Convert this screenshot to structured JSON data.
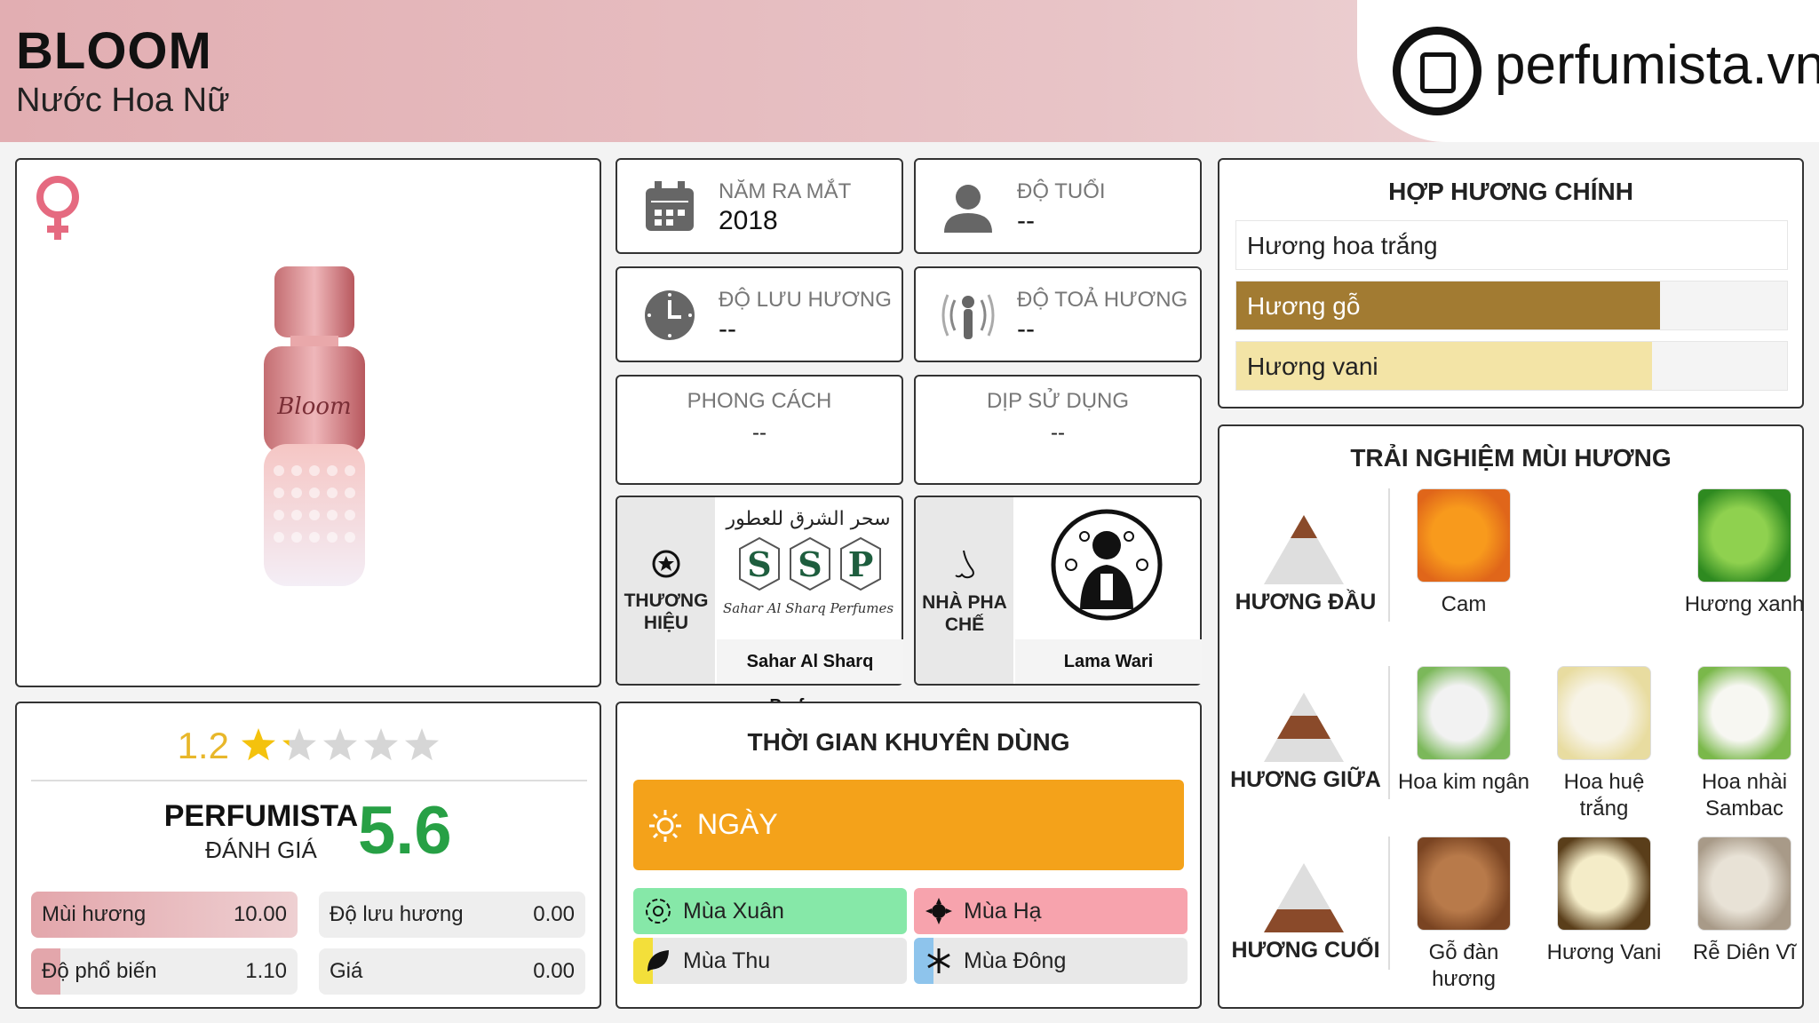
{
  "header": {
    "title": "BLOOM",
    "subtitle": "Nước Hoa Nữ",
    "logo_text": "perfumista.vn"
  },
  "info": {
    "launch_label": "NĂM RA MẮT",
    "launch_value": "2018",
    "age_label": "ĐỘ TUỔI",
    "age_value": "--",
    "longevity_label": "ĐỘ LƯU HƯƠNG",
    "longevity_value": "--",
    "sillage_label": "ĐỘ TOẢ HƯƠNG",
    "sillage_value": "--",
    "style_label": "PHONG CÁCH",
    "style_value": "--",
    "occasion_label": "DỊP SỬ DỤNG",
    "occasion_value": "--",
    "brand_label": "THƯƠNG HIỆU",
    "brand_name": "Sahar Al Sharq Perfumes",
    "brand_arabic": "سحر الشرق للعطور",
    "brand_script": "Sahar Al Sharq Perfumes",
    "perfumer_label": "NHÀ PHA CHẾ",
    "perfumer_name": "Lama Wari"
  },
  "bottle_text": "Bloom",
  "accords": {
    "title": "HỢP HƯƠNG CHÍNH",
    "items": [
      {
        "label": "Hương hoa trắng",
        "fill": 1.0,
        "color": "#ffffff"
      },
      {
        "label": "Hương gỗ",
        "fill": 0.77,
        "color": "#a27b32"
      },
      {
        "label": "Hương vani",
        "fill": 0.755,
        "color": "#f3e4a6"
      }
    ]
  },
  "notes": {
    "title": "TRẢI NGHIỆM MÙI HƯƠNG",
    "top_label": "HƯƠNG ĐẦU",
    "middle_label": "HƯƠNG GIỮA",
    "base_label": "HƯƠNG CUỐI",
    "top": [
      "Cam",
      "Hương xanh"
    ],
    "middle": [
      "Hoa kim ngân",
      "Hoa huệ trắng",
      "Hoa nhài Sambac"
    ],
    "base": [
      "Gỗ đàn hương",
      "Hương Vani",
      "Rễ Diên Vĩ"
    ]
  },
  "rating": {
    "score": "1.2",
    "stars": 1.2,
    "perfumista_label": "PERFUMISTA",
    "review_label": "ĐÁNH GIÁ",
    "perfumista_score": "5.6",
    "stats": [
      {
        "label": "Mùi hương",
        "value": "10.00",
        "fill": 1.0
      },
      {
        "label": "Độ lưu hương",
        "value": "0.00",
        "fill": 0
      },
      {
        "label": "Độ phổ biến",
        "value": "1.10",
        "fill": 0.11
      },
      {
        "label": "Giá",
        "value": "0.00",
        "fill": 0
      }
    ]
  },
  "time": {
    "title": "THỜI GIAN KHUYÊN DÙNG",
    "day_label": "NGÀY",
    "spring": "Mùa Xuân",
    "summer": "Mùa Hạ",
    "autumn": "Mùa Thu",
    "winter": "Mùa Đông"
  }
}
